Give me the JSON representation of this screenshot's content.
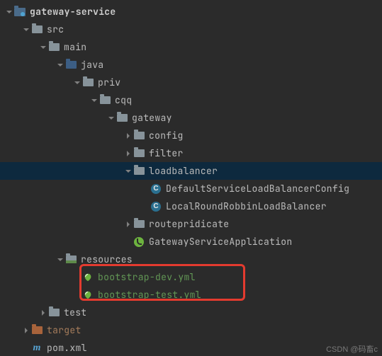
{
  "tree": {
    "root": "gateway-service",
    "src": "src",
    "main": "main",
    "java": "java",
    "priv": "priv",
    "cqq": "cqq",
    "gateway": "gateway",
    "config": "config",
    "filter": "filter",
    "loadbalancer": "loadbalancer",
    "default_cfg": "DefaultServiceLoadBalancerConfig",
    "local_rr": "LocalRoundRobbinLoadBalancer",
    "routepredicate": "routepridicate",
    "spring_app": "GatewayServiceApplication",
    "resources": "resources",
    "boot_dev": "bootstrap-dev.yml",
    "boot_test": "bootstrap-test.yml",
    "test": "test",
    "target": "target",
    "pom": "pom.xml"
  },
  "watermark": "CSDN @码畜c"
}
